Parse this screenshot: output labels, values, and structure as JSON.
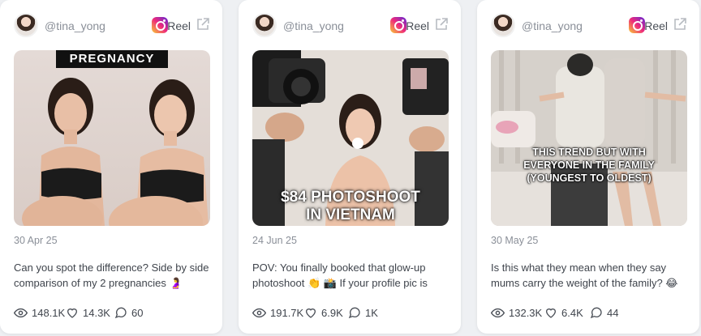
{
  "cards": [
    {
      "handle": "@tina_yong",
      "platform_icon": "instagram-icon",
      "type_label": "Reel",
      "thumbnail": {
        "banner_text": "PREGNANCY"
      },
      "date": "30 Apr 25",
      "caption": "Can you spot the difference? Side by side comparison of my 2 pregnancies 🤰",
      "stats": {
        "views": "148.1K",
        "likes": "14.3K",
        "comments": "60"
      }
    },
    {
      "handle": "@tina_yong",
      "platform_icon": "instagram-icon",
      "type_label": "Reel",
      "thumbnail": {
        "overlay_line1": "$84 PHOTOSHOOT",
        "overlay_line2": "IN VIETNAM"
      },
      "date": "24 Jun 25",
      "caption": "POV: You finally booked that glow-up photoshoot 👏 📸 If your profile pic is stil...",
      "stats": {
        "views": "191.7K",
        "likes": "6.9K",
        "comments": "1K"
      }
    },
    {
      "handle": "@tina_yong",
      "platform_icon": "instagram-icon",
      "type_label": "Reel",
      "thumbnail": {
        "overlay_line1": "THIS TREND BUT WITH",
        "overlay_line2": "EVERYONE IN THE FAMILY",
        "overlay_line3": "(YOUNGEST TO OLDEST)"
      },
      "date": "30 May 25",
      "caption": "Is this what they mean when they say mums carry the weight of the family? 😂",
      "stats": {
        "views": "132.3K",
        "likes": "6.4K",
        "comments": "44"
      }
    }
  ]
}
